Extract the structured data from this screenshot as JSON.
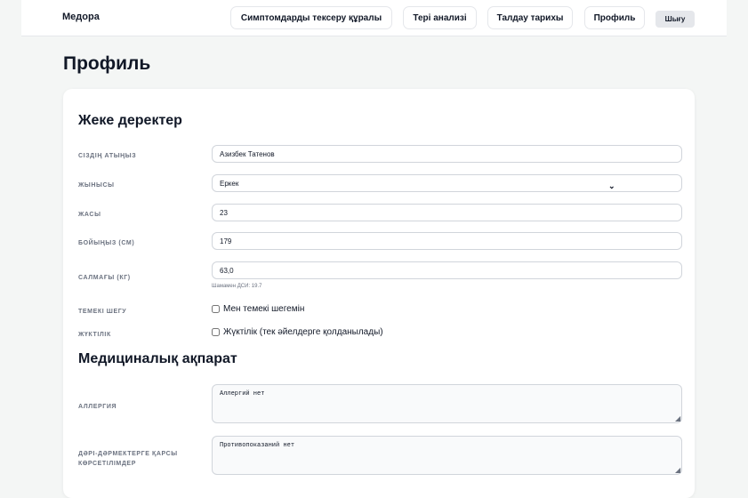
{
  "header": {
    "brand": "Медора",
    "nav": {
      "symptom_checker": "Симптомдарды тексеру құралы",
      "skin_analysis": "Тері анализі",
      "history": "Талдау тарихы",
      "profile": "Профиль",
      "logout": "Шығу"
    }
  },
  "page": {
    "title": "Профиль"
  },
  "personal": {
    "title": "Жеке деректер",
    "name": {
      "label": "Сіздің атыңыз",
      "value": "Азизбек Татенов"
    },
    "gender": {
      "label": "Жынысы",
      "value": "Еркек"
    },
    "age": {
      "label": "Жасы",
      "value": "23"
    },
    "height": {
      "label": "Бойыңыз (см)",
      "value": "179"
    },
    "weight": {
      "label": "Салмағы (кг)",
      "value": "63,0",
      "bmi_hint": "Шамамен ДСИ: 19.7"
    },
    "smoking": {
      "label": "Темекі шегу",
      "option": "Мен темекі шегемін",
      "checked": false
    },
    "pregnancy": {
      "label": "Жүктілік",
      "option": "Жүктілік (тек әйелдерге қолданылады)",
      "checked": false
    }
  },
  "medical": {
    "title": "Медициналық ақпарат",
    "allergy": {
      "label": "Аллергия",
      "value": "Аллергий нет"
    },
    "contraindications": {
      "label": "Дәрі-дәрмектерге қарсы көрсетілімдер",
      "value": "Противопоказаний нет"
    }
  }
}
